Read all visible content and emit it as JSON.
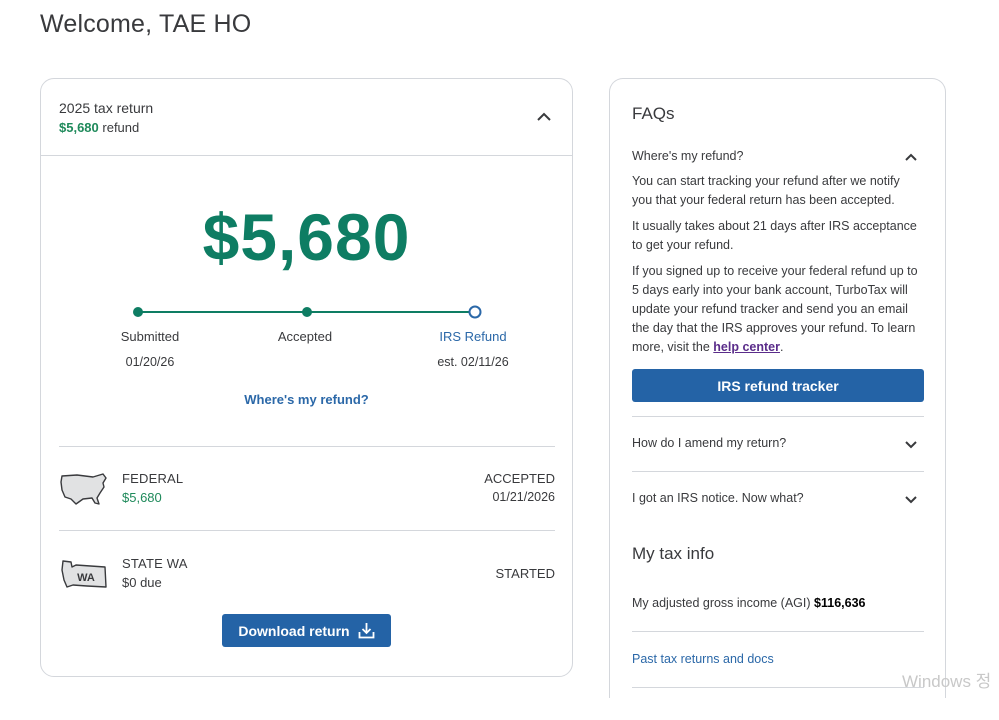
{
  "welcome": "Welcome, TAE HO",
  "return_card": {
    "title": "2025 tax return",
    "refund_amount": "$5,680",
    "refund_word": "refund",
    "big_amount": "$5,680",
    "steps": [
      {
        "label": "Submitted",
        "date": "01/20/26",
        "status": "done"
      },
      {
        "label": "Accepted",
        "date": "",
        "status": "done"
      },
      {
        "label": "IRS Refund",
        "date": "est. 02/11/26",
        "status": "pending"
      }
    ],
    "where_link": "Where's my refund?",
    "federal": {
      "name": "FEDERAL",
      "value": "$5,680",
      "status": "ACCEPTED",
      "date": "01/21/2026"
    },
    "state": {
      "name": "STATE WA",
      "value": "$0 due",
      "status": "STARTED",
      "badge": "WA"
    },
    "download_label": "Download return"
  },
  "faqs": {
    "title": "FAQs",
    "q1": "Where's my refund?",
    "p1": "You can start tracking your refund after we notify you that your federal return has been accepted.",
    "p2": "It usually takes about 21 days after IRS acceptance to get your refund.",
    "p3": "If you signed up to receive your federal refund up to 5 days early into your bank account, TurboTax will update your refund tracker and send you an email the day that the IRS approves your refund. To learn more, visit the",
    "help_link": "help center",
    "period": ".",
    "tracker_button": "IRS refund tracker",
    "q2": "How do I amend my return?",
    "q3": "I got an IRS notice. Now what?"
  },
  "tax_info": {
    "title": "My tax info",
    "agi_label": "My adjusted gross income (AGI)",
    "agi_value": "$116,636",
    "past_link": "Past tax returns and docs"
  },
  "watermark": "Windows 정",
  "colors": {
    "accent_green": "#0e7d63",
    "link_blue": "#2b68a8",
    "button_blue": "#2463a6",
    "help_purple": "#5a2c8a"
  }
}
